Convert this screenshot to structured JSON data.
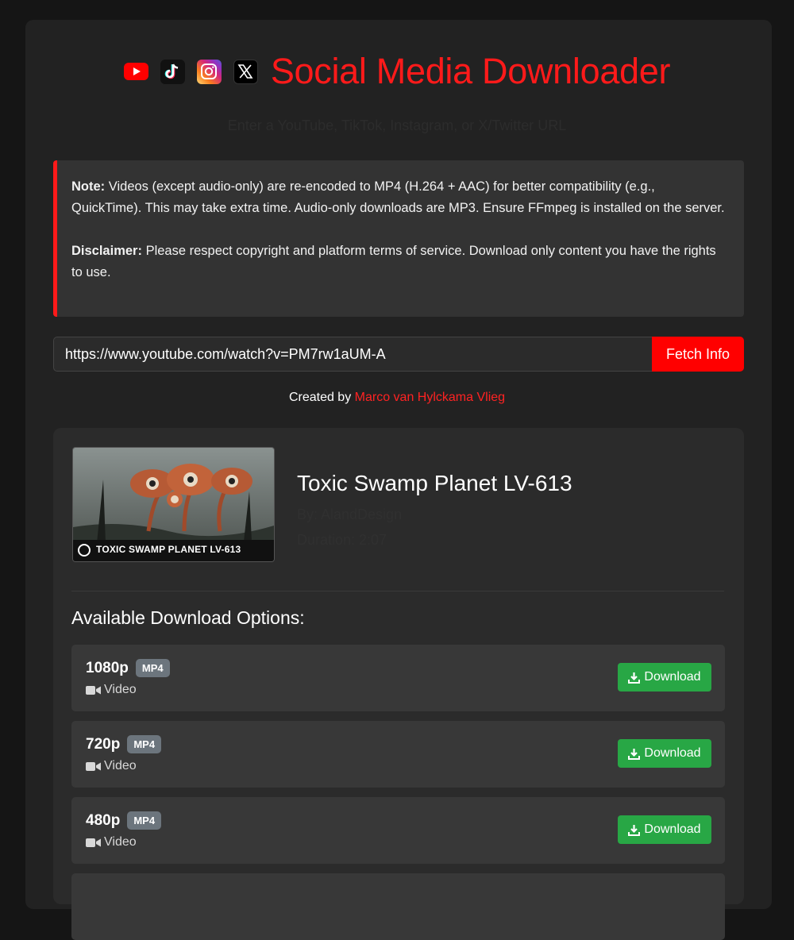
{
  "header": {
    "title": "Social Media Downloader",
    "subtitle": "Enter a YouTube, TikTok, Instagram, or X/Twitter URL",
    "icons": [
      "youtube-icon",
      "tiktok-icon",
      "instagram-icon",
      "x-icon"
    ]
  },
  "note": {
    "note_label": "Note:",
    "note_text": "Videos (except audio-only) are re-encoded to MP4 (H.264 + AAC) for better compatibility (e.g., QuickTime). This may take extra time. Audio-only downloads are MP3. Ensure FFmpeg is installed on the server.",
    "disclaimer_label": "Disclaimer:",
    "disclaimer_text": "Please respect copyright and platform terms of service. Download only content you have the rights to use."
  },
  "search": {
    "url_value": "https://www.youtube.com/watch?v=PM7rw1aUM-A",
    "fetch_label": "Fetch Info"
  },
  "credit": {
    "prefix": "Created by",
    "author": "Marco van Hylckama Vlieg"
  },
  "video": {
    "title": "Toxic Swamp Planet LV-613",
    "author": "By: AlandDesign",
    "duration": "Duration: 2:07",
    "thumbnail_caption": "TOXIC SWAMP PLANET LV-613"
  },
  "options": {
    "heading": "Available Download Options:",
    "items": [
      {
        "resolution": "1080p",
        "format": "MP4",
        "type": "Video",
        "button": "Download"
      },
      {
        "resolution": "720p",
        "format": "MP4",
        "type": "Video",
        "button": "Download"
      },
      {
        "resolution": "480p",
        "format": "MP4",
        "type": "Video",
        "button": "Download"
      }
    ]
  },
  "colors": {
    "accent": "#ff1a1a",
    "download": "#28a745",
    "badge": "#6c757d",
    "background": "#151515",
    "card": "#222222"
  }
}
